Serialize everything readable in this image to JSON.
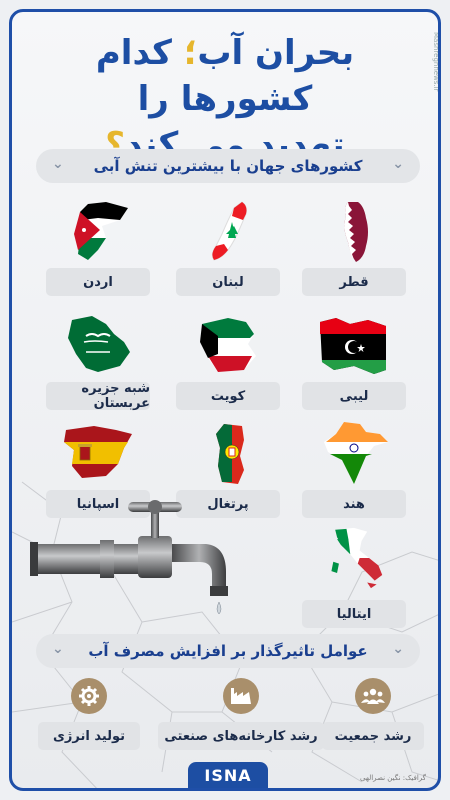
{
  "side_text": "Mashreghnews.ir",
  "title": {
    "line1_part1": "بحران آب",
    "line1_sep": "؛",
    "line1_part2": " کدام کشورها را",
    "line2_part1": "تهدید می کند",
    "line2_q": "؟"
  },
  "countries_section": {
    "title": "کشورهای جهان با بیشترین تنش آبی"
  },
  "countries": [
    {
      "name": "قطر",
      "flag": "qatar-flag-map-icon"
    },
    {
      "name": "لبنان",
      "flag": "lebanon-flag-map-icon"
    },
    {
      "name": "اردن",
      "flag": "jordan-flag-map-icon"
    },
    {
      "name": "لیبی",
      "flag": "libya-flag-map-icon"
    },
    {
      "name": "کویت",
      "flag": "kuwait-flag-map-icon"
    },
    {
      "name": "شبه جزیره عربستان",
      "flag": "saudi-flag-map-icon"
    },
    {
      "name": "هند",
      "flag": "india-flag-map-icon"
    },
    {
      "name": "پرتغال",
      "flag": "portugal-flag-map-icon"
    },
    {
      "name": "اسپانیا",
      "flag": "spain-flag-map-icon"
    },
    {
      "name": "ایتالیا",
      "flag": "italy-flag-map-icon"
    }
  ],
  "factors_section": {
    "title": "عوامل تاثیرگذار بر افزایش مصرف آب"
  },
  "factors": [
    {
      "label": "رشد جمعیت",
      "icon": "people-icon"
    },
    {
      "label": "رشد کارخانه‌های صنعتی",
      "icon": "factory-icon"
    },
    {
      "label": "تولید انرژی",
      "icon": "gear-icon"
    }
  ],
  "footer": {
    "logo": "ISNA",
    "credit": "گرافیک: نگین نصرالهی"
  },
  "colors": {
    "brand_blue": "#1d4ea3",
    "accent_yellow": "#e6b62d"
  }
}
